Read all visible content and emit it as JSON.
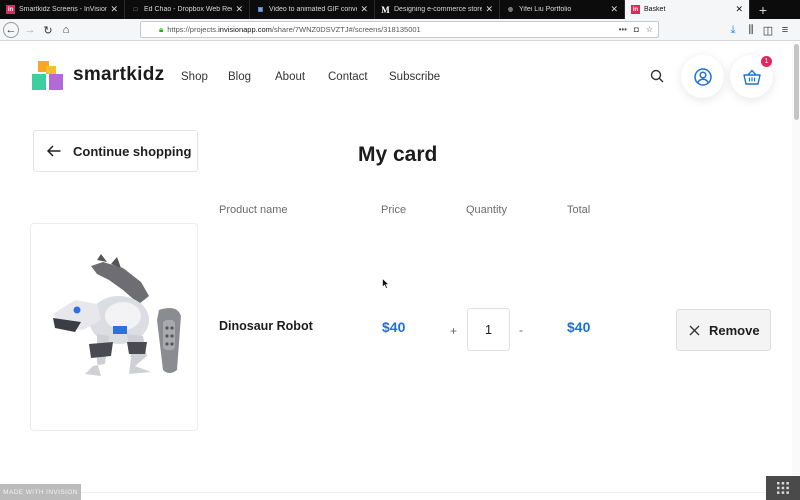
{
  "browser": {
    "tabs": [
      {
        "title": "Smartkidz Screens - InVision",
        "favicon": "in",
        "fav_bg": "#e3275d"
      },
      {
        "title": "Ed Chao - Dropbox Web Redes",
        "favicon": "□",
        "fav_bg": "#333333"
      },
      {
        "title": "Video to animated GIF converte",
        "favicon": "▣",
        "fav_bg": "#2a4a8a"
      },
      {
        "title": "Designing e-commerce store w",
        "favicon": "M",
        "fav_bg": "#000000"
      },
      {
        "title": "Yifei Liu Portfolio",
        "favicon": "◍",
        "fav_bg": "#444444"
      },
      {
        "title": "Basket",
        "favicon": "in",
        "fav_bg": "#e3275d"
      }
    ],
    "active_tab_index": 5,
    "url_prefix": "https://projects.",
    "url_host": "invisionapp.com",
    "url_path": "/share/7WNZ0DSVZTJ#/screens/318135001"
  },
  "site": {
    "brand": "smartkidz",
    "nav": [
      "Shop",
      "Blog",
      "About",
      "Contact",
      "Subscribe"
    ],
    "cart_count": "1",
    "continue_label": "Continue shopping",
    "page_title": "My card",
    "columns": {
      "product": "Product name",
      "price": "Price",
      "quantity": "Quantity",
      "total": "Total"
    },
    "item": {
      "name": "Dinosaur Robot",
      "price": "$40",
      "quantity": "1",
      "total": "$40",
      "plus": "+",
      "minus": "-"
    },
    "remove_label": "Remove",
    "made_with": "MADE WITH INVISION"
  },
  "colors": {
    "accent": "#1f6fd6",
    "badge": "#e3275d"
  }
}
